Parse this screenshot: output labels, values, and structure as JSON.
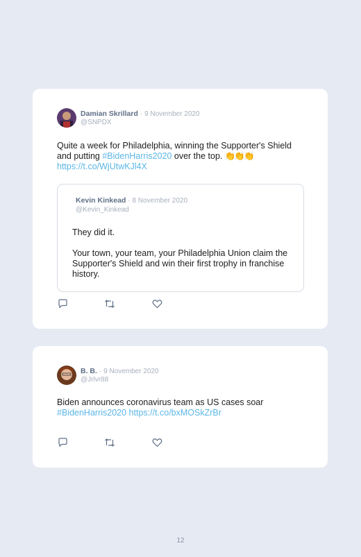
{
  "tweets": [
    {
      "author": "Damian Skrillard",
      "separator": "·",
      "date": "9 November 2020",
      "handle": "@SNPDX",
      "text_before": "Quite a week for Philadelphia, winning the Supporter's Shield and putting ",
      "hashtag": "#BidenHarris2020",
      "text_after": " over the top. ",
      "emoji": "👏👏👏",
      "link": "https://t.co/WjUtwKJl4X",
      "quoted": {
        "author": "Kevin Kinkead",
        "separator": "·",
        "date": "8 November 2020",
        "handle": "@Kevin_Kinkead",
        "paragraph1": "They did it.",
        "paragraph2": "Your town, your team, your Philadelphia Union claim the Supporter's Shield and win their first trophy in franchise history."
      },
      "actions": [
        "reply-icon",
        "retweet-icon",
        "like-icon"
      ]
    },
    {
      "author": "B. B.",
      "separator": "·",
      "date": "9 November 2020",
      "handle": "@Jrlvr88",
      "text": "Biden announces coronavirus team as US cases soar",
      "hashtag": "#BidenHarris2020",
      "link": "https://t.co/bxMOSkZrBr",
      "actions": [
        "reply-icon",
        "retweet-icon",
        "like-icon"
      ]
    }
  ],
  "page_number": "12",
  "colors": {
    "background": "#e6eaf3",
    "card": "#ffffff",
    "link": "#5bb6e6",
    "name": "#5f6f86",
    "muted": "#a7b0bd",
    "icon": "#5f6f86"
  }
}
